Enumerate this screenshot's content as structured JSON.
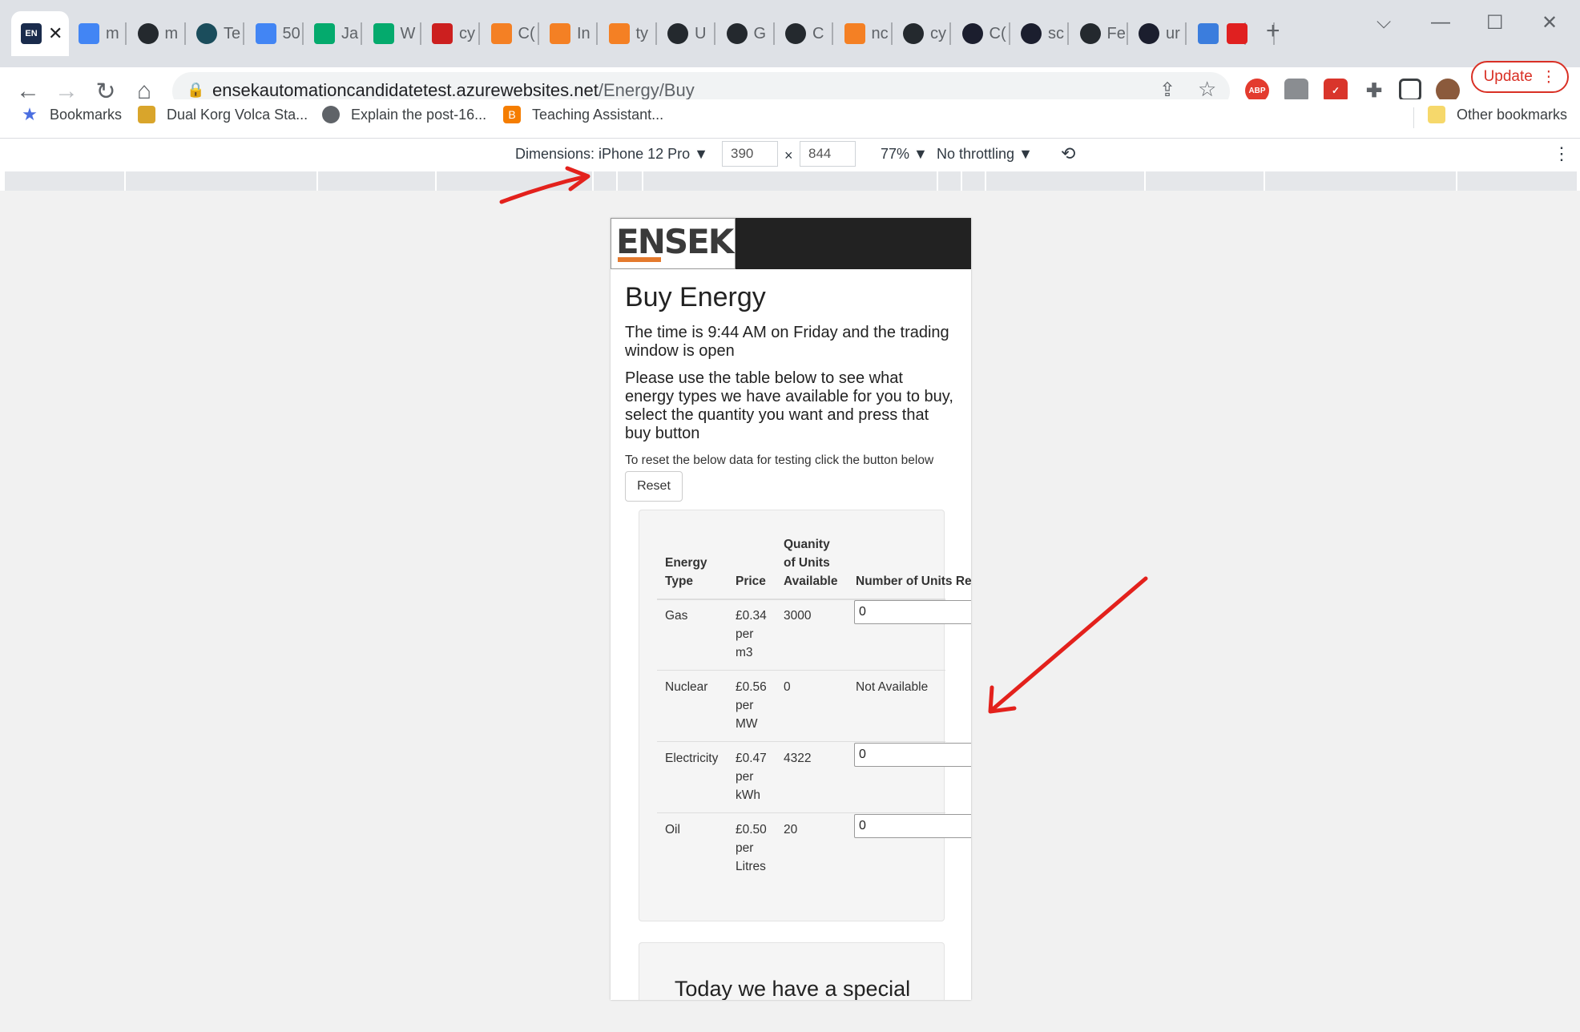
{
  "browser": {
    "tabs": [
      {
        "title": "EN",
        "favicon": "ensek-icon",
        "color": "#1a2b4c",
        "active": true
      },
      {
        "title": "m",
        "favicon": "google-icon",
        "color": "#4285f4"
      },
      {
        "title": "m",
        "favicon": "github-icon",
        "color": "#24292e"
      },
      {
        "title": "Te",
        "favicon": "cheatsheet-icon",
        "color": "#1b4d5c"
      },
      {
        "title": "50",
        "favicon": "google-icon",
        "color": "#4285f4"
      },
      {
        "title": "Ja",
        "favicon": "w3schools-icon",
        "color": "#04aa6d"
      },
      {
        "title": "W",
        "favicon": "w3schools-icon",
        "color": "#04aa6d"
      },
      {
        "title": "cy",
        "favicon": "red-square-icon",
        "color": "#cc1f1f"
      },
      {
        "title": "C(",
        "favicon": "stackoverflow-icon",
        "color": "#f48024"
      },
      {
        "title": "In",
        "favicon": "stackoverflow-icon",
        "color": "#f48024"
      },
      {
        "title": "ty",
        "favicon": "stackoverflow-icon",
        "color": "#f48024"
      },
      {
        "title": "U",
        "favicon": "github-icon",
        "color": "#24292e"
      },
      {
        "title": "G",
        "favicon": "github-icon",
        "color": "#24292e"
      },
      {
        "title": "C",
        "favicon": "github-icon",
        "color": "#24292e"
      },
      {
        "title": "nc",
        "favicon": "stackoverflow-icon",
        "color": "#f48024"
      },
      {
        "title": "cy",
        "favicon": "github-icon",
        "color": "#24292e"
      },
      {
        "title": "C(",
        "favicon": "cypress-icon",
        "color": "#1b1e2e"
      },
      {
        "title": "sc",
        "favicon": "cypress-icon",
        "color": "#1b1e2e"
      },
      {
        "title": "Fe",
        "favicon": "github-icon",
        "color": "#24292e"
      },
      {
        "title": "ur",
        "favicon": "cypress-icon",
        "color": "#1b1e2e"
      },
      {
        "title": "",
        "favicon": "d-icon",
        "color": "#3b7ddd"
      },
      {
        "title": "",
        "favicon": "heart-icon",
        "color": "#e02020"
      }
    ],
    "new_tab_label": "+",
    "url_domain": "ensekautomationcandidatetest.azurewebsites.net",
    "url_path": "/Energy/Buy",
    "update_label": "Update",
    "bookmarks": [
      {
        "label": "Bookmarks",
        "icon": "star-icon"
      },
      {
        "label": "Dual Korg Volca Sta...",
        "icon": "korg-icon"
      },
      {
        "label": "Explain the post-16...",
        "icon": "globe-icon"
      },
      {
        "label": "Teaching Assistant...",
        "icon": "blogger-icon"
      }
    ],
    "other_bookmarks": "Other bookmarks"
  },
  "devtools": {
    "dimensions_label": "Dimensions: iPhone 12 Pro",
    "width": "390",
    "x_sep": "×",
    "height": "844",
    "zoom": "77%",
    "throttling": "No throttling"
  },
  "page": {
    "logo_text": "ENSEK",
    "title": "Buy Energy",
    "time_text": "The time is 9:44 AM on Friday and the trading window is open",
    "instructions": "Please use the table below to see what energy types we have available for you to buy, select the quantity you want and press that buy button",
    "reset_note": "To reset the below data for testing click the button below",
    "reset_label": "Reset",
    "table": {
      "headers": {
        "type": [
          "Energy",
          "Type"
        ],
        "price": "Price",
        "qty": [
          "Quanity",
          "of Units",
          "Available"
        ],
        "req": "Number of Units Re"
      },
      "rows": [
        {
          "type": "Gas",
          "price": [
            "£0.34",
            "per",
            "m3"
          ],
          "qty": "3000",
          "units": "0"
        },
        {
          "type": "Nuclear",
          "price": [
            "£0.56",
            "per",
            "MW"
          ],
          "qty": "0",
          "units": "Not Available"
        },
        {
          "type": "Electricity",
          "price": [
            "£0.47",
            "per",
            "kWh"
          ],
          "qty": "4322",
          "units": "0"
        },
        {
          "type": "Oil",
          "price": [
            "£0.50",
            "per",
            "Litres"
          ],
          "qty": "20",
          "units": "0"
        }
      ]
    },
    "special_title": "Today we have a special"
  },
  "colors": {
    "annotation": "#e3211c",
    "logo_accent": "#e47a2e",
    "header_bg": "#222222"
  }
}
